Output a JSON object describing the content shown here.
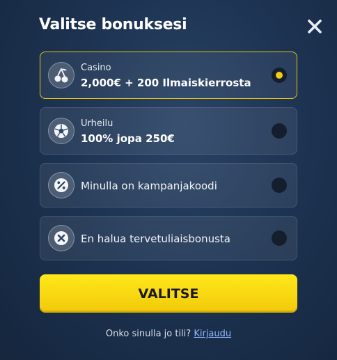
{
  "modal": {
    "title": "Valitse bonuksesi"
  },
  "options": [
    {
      "icon": "cherry-icon",
      "category": "Casino",
      "offer": "2,000€ + 200 Ilmaiskierrosta",
      "selected": true
    },
    {
      "icon": "football-icon",
      "category": "Urheilu",
      "offer": "100% jopa 250€",
      "selected": false
    },
    {
      "icon": "percent-icon",
      "label": "Minulla on kampanjakoodi",
      "selected": false
    },
    {
      "icon": "x-circle-icon",
      "label": "En halua tervetuliaisbonusta",
      "selected": false
    }
  ],
  "cta": {
    "label": "VALITSE"
  },
  "footer": {
    "question": "Onko sinulla jo tili?",
    "link": "Kirjaudu"
  },
  "colors": {
    "accent": "#f2cc0f",
    "link": "#8fb8ff",
    "background": "#1d3352"
  }
}
